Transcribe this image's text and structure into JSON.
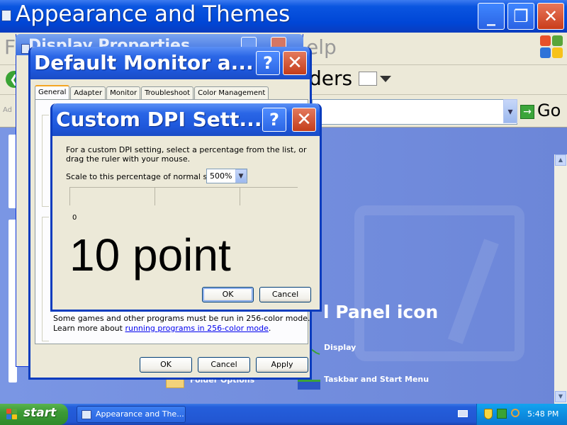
{
  "explorer": {
    "title": "Appearance and Themes",
    "title_buttons": {
      "minimize": "_",
      "maximize": "❐",
      "close": "✕"
    },
    "menu_fragment_left": "F",
    "menu_fragment_right": "elp",
    "toolbar": {
      "back_glyph": "❮",
      "folders_fragment": "ders"
    },
    "address": {
      "label_fragment": "Ad",
      "go_label": "Go"
    },
    "heading_fragment": "l Panel icon",
    "links": {
      "display": "Display",
      "taskbar": "Taskbar and Start Menu",
      "folder_options": "Folder Options"
    }
  },
  "display_properties": {
    "title_fragment": "Display Properties"
  },
  "monitor_dialog": {
    "title": "Default Monitor a...",
    "help": "?",
    "close": "✕",
    "tabs": [
      "General",
      "Adapter",
      "Monitor",
      "Troubleshoot",
      "Color Management"
    ],
    "active_tab": "General",
    "note_line1": "Some games and other programs must be run in 256-color mode.",
    "note_prefix": "Learn more about ",
    "note_link": "running programs in 256-color mode",
    "note_suffix": ".",
    "buttons": {
      "ok": "OK",
      "cancel": "Cancel",
      "apply": "Apply"
    }
  },
  "dpi_dialog": {
    "title": "Custom DPI Sett...",
    "help": "?",
    "close": "✕",
    "instructions_line1": "For a custom DPI setting, select a percentage from the list, or",
    "instructions_line2": "drag the ruler with your mouse.",
    "scale_label": "Scale to this percentage of normal size:",
    "scale_value": "500%",
    "ruler_zero": "0",
    "sample_text": "10 point",
    "buttons": {
      "ok": "OK",
      "cancel": "Cancel"
    }
  },
  "taskbar": {
    "start_label": "start",
    "task_label": "Appearance and The...",
    "clock": "5:48 PM"
  },
  "colors": {
    "titlebar_blue": "#0046d6",
    "dialog_bg": "#ece9d8",
    "close_red": "#c93d1a",
    "start_green": "#3c9a35",
    "tray_blue": "#0d8ee0",
    "content_blue": "#6b86dd"
  },
  "icons": [
    "window-icon",
    "back-icon",
    "views-icon",
    "go-icon",
    "windows-flag-icon",
    "display-icon",
    "taskbar-icon",
    "folder-icon",
    "keyboard-icon",
    "security-shield-icon",
    "network-icon",
    "search-icon",
    "help-icon",
    "close-icon"
  ]
}
